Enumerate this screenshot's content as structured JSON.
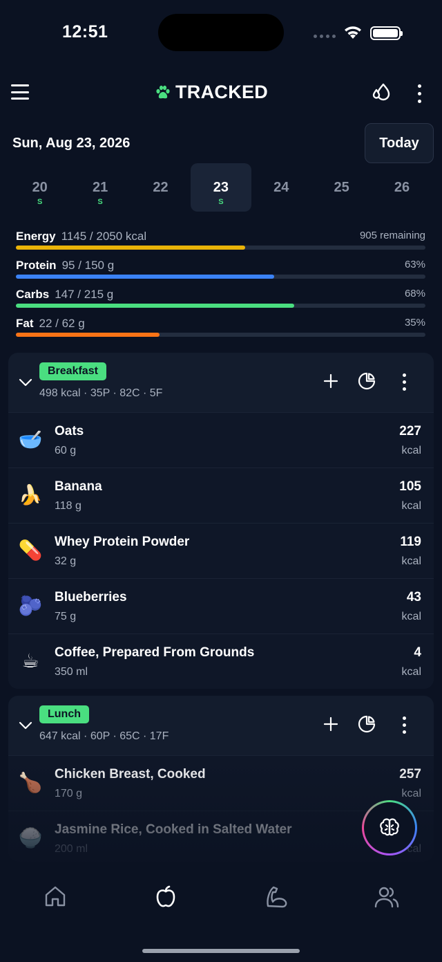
{
  "status": {
    "time": "12:51"
  },
  "app": {
    "title": "TRACKED"
  },
  "date": {
    "label": "Sun, Aug 23, 2026",
    "today_label": "Today"
  },
  "week": [
    {
      "num": "20",
      "mark": "S",
      "selected": false
    },
    {
      "num": "21",
      "mark": "S",
      "selected": false
    },
    {
      "num": "22",
      "mark": "",
      "selected": false
    },
    {
      "num": "23",
      "mark": "S",
      "selected": true
    },
    {
      "num": "24",
      "mark": "",
      "selected": false
    },
    {
      "num": "25",
      "mark": "",
      "selected": false
    },
    {
      "num": "26",
      "mark": "",
      "selected": false
    }
  ],
  "macros": [
    {
      "name": "Energy",
      "amount": "1145 / 2050 kcal",
      "right": "905 remaining",
      "fraction": 0.56,
      "color": "#eab308"
    },
    {
      "name": "Protein",
      "amount": "95 / 150 g",
      "right": "63%",
      "fraction": 0.63,
      "color": "#3b82f6"
    },
    {
      "name": "Carbs",
      "amount": "147 / 215 g",
      "right": "68%",
      "fraction": 0.68,
      "color": "#4ade80"
    },
    {
      "name": "Fat",
      "amount": "22 / 62 g",
      "right": "35%",
      "fraction": 0.35,
      "color": "#f97316"
    }
  ],
  "meals": [
    {
      "name": "Breakfast",
      "summary": "498 kcal · 35P · 82C · 5F",
      "items": [
        {
          "emoji": "🥣",
          "name": "Oats",
          "qty": "60 g",
          "kcal": "227",
          "unit": "kcal"
        },
        {
          "emoji": "🍌",
          "name": "Banana",
          "qty": "118 g",
          "kcal": "105",
          "unit": "kcal"
        },
        {
          "emoji": "💊",
          "name": "Whey Protein Powder",
          "qty": "32 g",
          "kcal": "119",
          "unit": "kcal"
        },
        {
          "emoji": "🫐",
          "name": "Blueberries",
          "qty": "75 g",
          "kcal": "43",
          "unit": "kcal"
        },
        {
          "emoji": "☕",
          "name": "Coffee, Prepared From Grounds",
          "qty": "350 ml",
          "kcal": "4",
          "unit": "kcal"
        }
      ]
    },
    {
      "name": "Lunch",
      "summary": "647 kcal · 60P · 65C · 17F",
      "items": [
        {
          "emoji": "🍗",
          "name": "Chicken Breast, Cooked",
          "qty": "170 g",
          "kcal": "257",
          "unit": "kcal"
        },
        {
          "emoji": "🍚",
          "name": "Jasmine Rice, Cooked in Salted Water",
          "qty": "200 ml",
          "kcal": "",
          "unit": "cal"
        }
      ]
    }
  ],
  "icons": {
    "menu": "hamburger-icon",
    "logo": "paw-icon",
    "water": "water-drops-icon",
    "more": "more-vertical-icon",
    "add": "plus-icon",
    "pie": "pie-chart-icon",
    "fab": "brain-icon"
  },
  "tabs": [
    "home-icon",
    "apple-icon",
    "flexed-arm-icon",
    "users-icon"
  ],
  "colors": {
    "bg": "#0b1222",
    "accent": "#4ade80"
  }
}
